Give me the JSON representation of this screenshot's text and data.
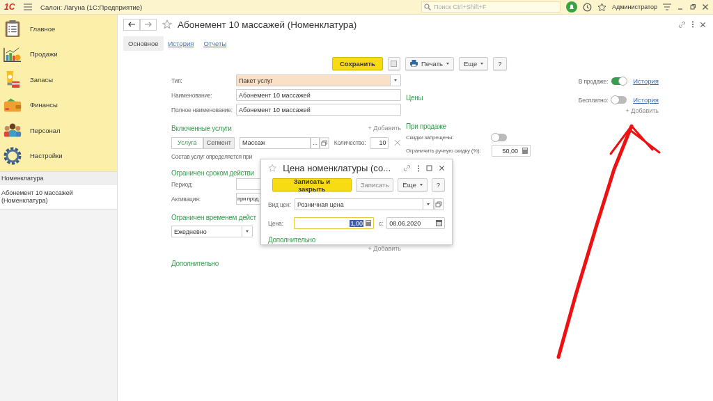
{
  "app": {
    "logo": "1С",
    "title": "Салон: Лагуна  (1С:Предприятие)",
    "search": {
      "placeholder": "Поиск Ctrl+Shift+F"
    },
    "user": "Администратор"
  },
  "sections": [
    {
      "label": "Главное",
      "kind": "home"
    },
    {
      "label": "Продажи",
      "kind": "sales"
    },
    {
      "label": "Запасы",
      "kind": "stock"
    },
    {
      "label": "Финансы",
      "kind": "finance"
    },
    {
      "label": "Персонал",
      "kind": "staff"
    },
    {
      "label": "Настройки",
      "kind": "settings"
    }
  ],
  "open_windows": {
    "header": "Номенклатура",
    "items": [
      {
        "label": "Абонемент 10 массажей (Номенклатура)",
        "selected": true
      }
    ]
  },
  "form": {
    "title": "Абонемент 10 массажей (Номенклатура)",
    "tabs": [
      {
        "label": "Основное",
        "selected": true
      },
      {
        "label": "История",
        "selected": false
      },
      {
        "label": "Отчеты",
        "selected": false
      }
    ],
    "commands": [
      {
        "label": "Сохранить",
        "kind": "primary"
      },
      {
        "kind": "icon"
      },
      {
        "label": "Печать",
        "kind": "print"
      },
      {
        "label": "Еще",
        "kind": "menu"
      },
      {
        "label": "?",
        "kind": "plain"
      }
    ],
    "fields": [
      {
        "label": "Тип:",
        "value": "Пакет услуг",
        "kind": "select"
      },
      {
        "label": "Наименование:",
        "value": "Абонемент 10 массажей",
        "kind": "text"
      },
      {
        "label": "Полное наименование:",
        "value": "Абонемент 10 массажей",
        "kind": "text"
      }
    ],
    "included": {
      "title": "Включенные услуги",
      "add": "+ Добавить",
      "modes": [
        {
          "label": "Услуга",
          "selected": true
        },
        {
          "label": "Сегмент",
          "selected": false
        }
      ],
      "service": "Массаж",
      "ellipsis": "...",
      "qty_label": "Количество:",
      "qty": "10",
      "note": "Состав услуг определяется при"
    },
    "term": {
      "title": "Ограничен сроком действи",
      "period_label": "Период:",
      "activation_label": "Активация:",
      "activation": "при прод"
    },
    "time": {
      "title": "Ограничен временем дейст",
      "schedule": "Ежедневно",
      "add": "+ Добавить"
    },
    "extra": "Дополнительно",
    "prices": {
      "title": "Цены",
      "on_sale": {
        "title": "При продаже",
        "no_discounts": {
          "label": "Скидки запрещены:",
          "on": false
        },
        "limit": {
          "label": "Ограничить ручную скидку (%):",
          "value": "50,00"
        }
      }
    },
    "flags": [
      {
        "label": "В продаже:",
        "on": true,
        "link": "История"
      },
      {
        "label": "Бесплатно:",
        "on": false,
        "link": "История"
      }
    ],
    "flags_add": "+ Добавить"
  },
  "dialog": {
    "title": "Цена номенклатуры (со...",
    "commands": [
      {
        "label": "Записать и закрыть",
        "kind": "primary"
      },
      {
        "label": "Записать",
        "kind": "plain"
      },
      {
        "label": "Еще",
        "kind": "menu"
      },
      {
        "label": "?",
        "kind": "plain"
      }
    ],
    "price_type": {
      "label": "Вид цен:",
      "value": "Розничная цена"
    },
    "price": {
      "label": "Цена:",
      "value": "1,00",
      "highlighted": true
    },
    "date": {
      "label": "с:",
      "value": "08.06.2020"
    },
    "extra": "Дополнительно"
  }
}
